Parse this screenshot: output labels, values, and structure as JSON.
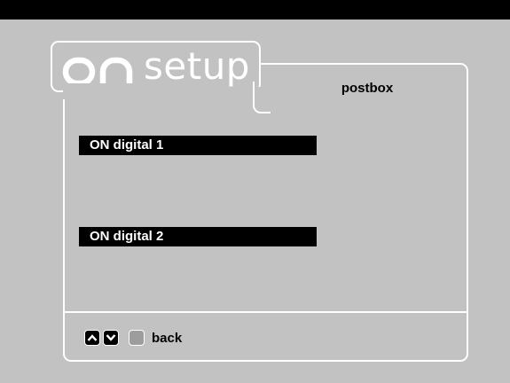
{
  "screen": {
    "brand": "on",
    "title": "setup",
    "tab_label": "postbox"
  },
  "menu": {
    "items": [
      {
        "label": "ON digital 1"
      },
      {
        "label": "ON digital 2"
      }
    ]
  },
  "footer": {
    "up_icon": "chevron-up-icon",
    "down_icon": "chevron-down-icon",
    "grey_key_icon": "grey-key-icon",
    "back_label": "back"
  },
  "colors": {
    "background": "#c2c2c2",
    "panel_border": "#ffffff",
    "highlight_bg": "#000000",
    "highlight_text": "#ffffff"
  }
}
